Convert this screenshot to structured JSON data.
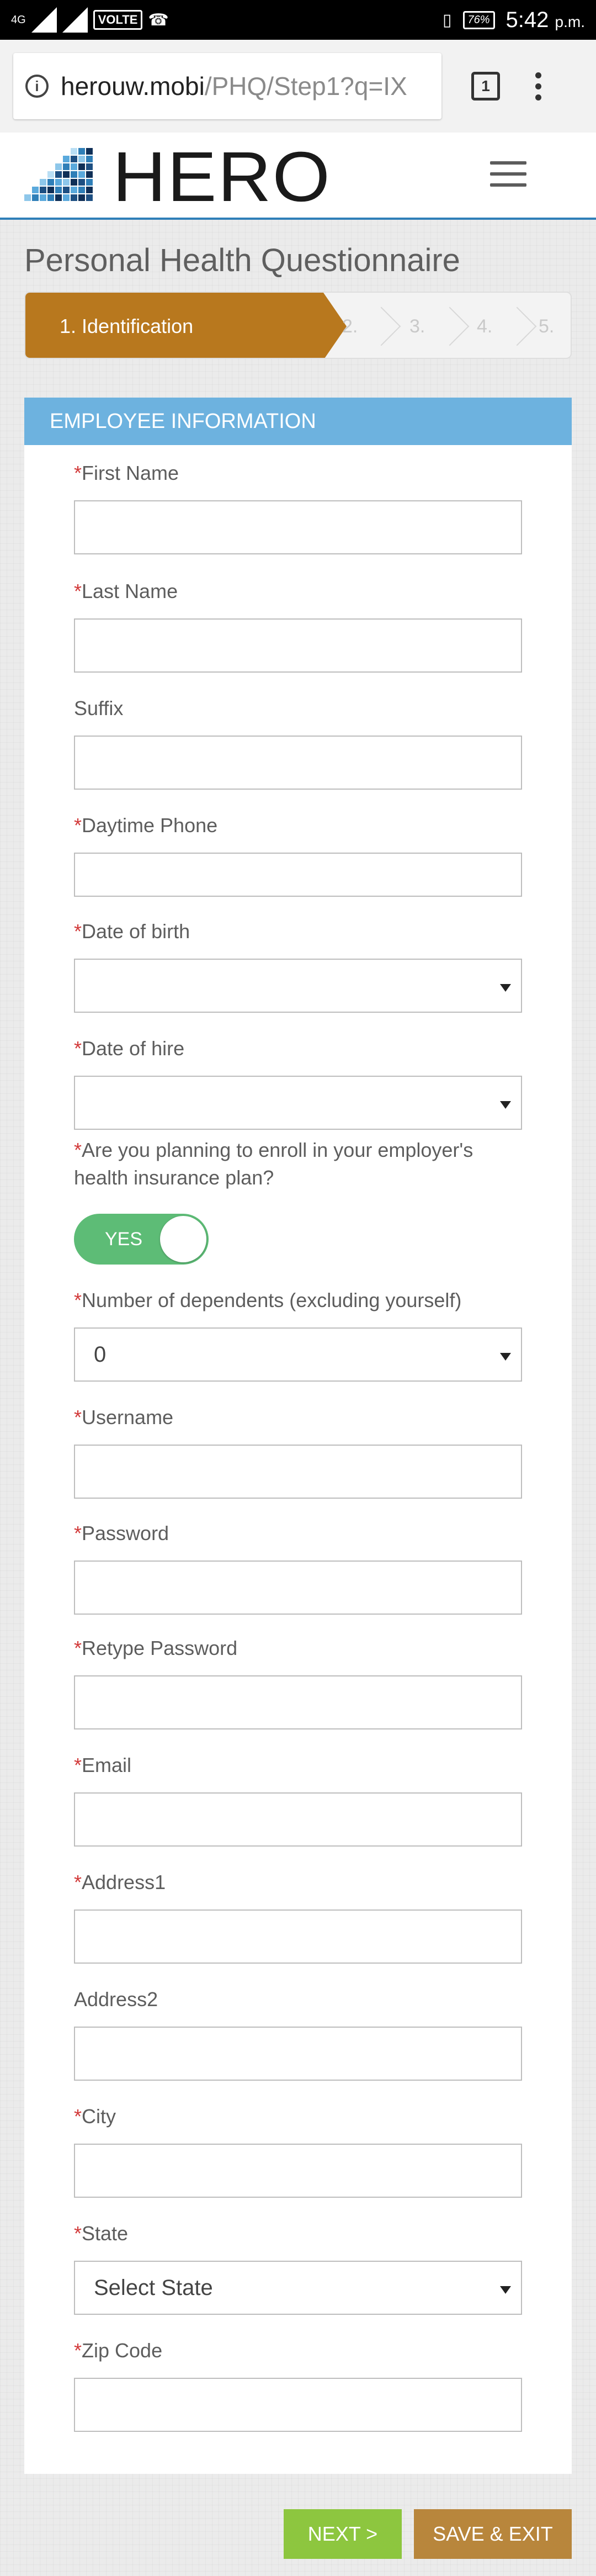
{
  "status_bar": {
    "network": "4G",
    "volte": "VOLTE",
    "battery": "76%",
    "time": "5:42",
    "ampm": "p.m."
  },
  "browser": {
    "url_host": "herouw.mobi",
    "url_path": "/PHQ/Step1?q=IX",
    "tab_count": "1"
  },
  "header": {
    "logo_text": "HERO"
  },
  "page": {
    "title": "Personal Health Questionnaire"
  },
  "stepper": {
    "steps": [
      {
        "label": "1. Identification",
        "active": true
      },
      {
        "label": "2.",
        "active": false
      },
      {
        "label": "3.",
        "active": false
      },
      {
        "label": "4.",
        "active": false
      },
      {
        "label": "5.",
        "active": false
      }
    ]
  },
  "form": {
    "section_title": "EMPLOYEE INFORMATION",
    "required_mark": "*",
    "fields": {
      "first_name": {
        "label": "First Name",
        "value": ""
      },
      "last_name": {
        "label": "Last Name",
        "value": ""
      },
      "suffix": {
        "label": "Suffix",
        "value": ""
      },
      "daytime_phone": {
        "label": "Daytime Phone",
        "value": ""
      },
      "date_of_birth": {
        "label": "Date of birth",
        "value": ""
      },
      "date_of_hire": {
        "label": "Date of hire",
        "value": ""
      },
      "enroll_question": {
        "label_line1": "Are you planning to enroll in your employer's",
        "label_line2": "health insurance plan?",
        "toggle_label": "YES"
      },
      "dependents": {
        "label": "Number of dependents (excluding yourself)",
        "value": "0"
      },
      "username": {
        "label": "Username",
        "value": ""
      },
      "password": {
        "label": "Password",
        "value": ""
      },
      "retype_password": {
        "label": "Retype Password",
        "value": ""
      },
      "email": {
        "label": "Email",
        "value": ""
      },
      "address1": {
        "label": "Address1",
        "value": ""
      },
      "address2": {
        "label": "Address2",
        "value": ""
      },
      "city": {
        "label": "City",
        "value": ""
      },
      "state": {
        "label": "State",
        "value": "Select State"
      },
      "zip": {
        "label": "Zip Code",
        "value": ""
      }
    }
  },
  "actions": {
    "next": "NEXT >",
    "save_exit": "SAVE & EXIT"
  },
  "colors": {
    "step_active": "#b8781e",
    "section_header": "#6db2df",
    "next_button": "#8dc63f",
    "save_button": "#b8863c",
    "toggle_on": "#5dbc76",
    "required": "#d23a3a"
  }
}
